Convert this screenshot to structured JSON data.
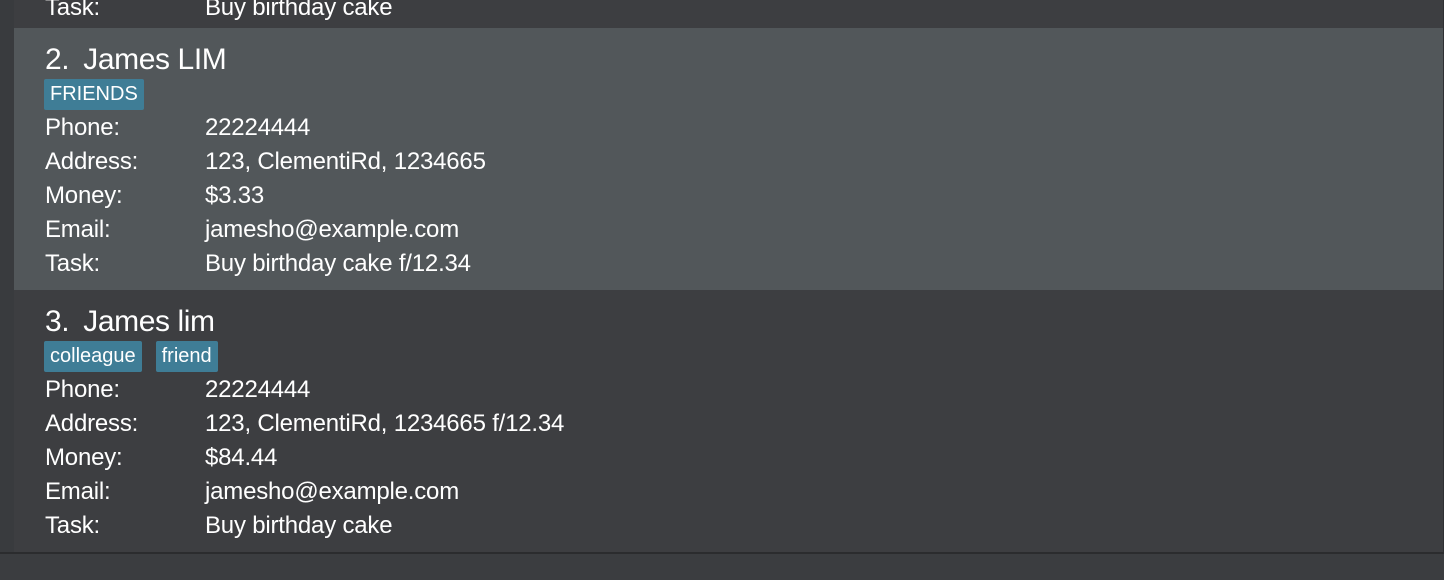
{
  "persons": [
    {
      "task_label": "Task:",
      "task": "Buy birthday cake"
    },
    {
      "index": "2.",
      "name": "James LIM",
      "tags": [
        "FRIENDS"
      ],
      "phone_label": "Phone:",
      "phone": "22224444",
      "address_label": "Address:",
      "address": "123, ClementiRd, 1234665",
      "money_label": "Money:",
      "money": "$3.33",
      "email_label": "Email:",
      "email": "jamesho@example.com",
      "task_label": "Task:",
      "task": "Buy birthday cake f/12.34"
    },
    {
      "index": "3.",
      "name": "James lim",
      "tags": [
        "colleague",
        "friend"
      ],
      "phone_label": "Phone:",
      "phone": "22224444",
      "address_label": "Address:",
      "address": "123, ClementiRd, 1234665 f/12.34",
      "money_label": "Money:",
      "money": "$84.44",
      "email_label": "Email:",
      "email": "jamesho@example.com",
      "task_label": "Task:",
      "task": "Buy birthday cake"
    }
  ],
  "colors": {
    "background": "#393b3e",
    "card": "#3d3e41",
    "selected_card": "#52575a",
    "tag": "#3f7d96",
    "text": "#ffffff"
  }
}
